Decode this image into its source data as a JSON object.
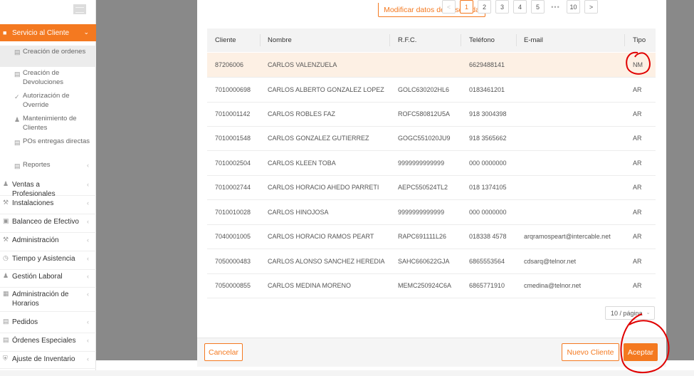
{
  "sidebar": {
    "active_menu": "Servicio al Cliente",
    "subitems": [
      {
        "label": "Creación de ordenes",
        "icon": "table-icon"
      },
      {
        "label": "Creación de Devoluciones",
        "icon": "return-icon"
      },
      {
        "label": "Autorización de Override",
        "icon": "check-icon"
      },
      {
        "label": "Mantenimiento de Clientes",
        "icon": "user-icon"
      },
      {
        "label": "POs entregas directas",
        "icon": "table-icon"
      },
      {
        "label": "Reportes",
        "icon": "table-icon"
      }
    ],
    "menus": [
      {
        "label": "Ventas a Profesionales",
        "icon": "user-icon"
      },
      {
        "label": "Instalaciones",
        "icon": "wrench-icon"
      },
      {
        "label": "Balanceo de Efectivo",
        "icon": "cash-icon"
      },
      {
        "label": "Administración",
        "icon": "wrench-icon"
      },
      {
        "label": "Tiempo y Asistencia",
        "icon": "clock-icon"
      },
      {
        "label": "Gestión Laboral",
        "icon": "users-icon"
      },
      {
        "label": "Administración de Horarios",
        "icon": "calendar-icon"
      },
      {
        "label": "Pedidos",
        "icon": "document-icon"
      },
      {
        "label": "Órdenes Especiales",
        "icon": "document-icon"
      },
      {
        "label": "Ajuste de Inventario",
        "icon": "shield-icon"
      }
    ]
  },
  "modal": {
    "modify_label": "Modificar datos de búsqueda",
    "columns": [
      "Cliente",
      "Nombre",
      "R.F.C.",
      "Teléfono",
      "E-mail",
      "Tipo"
    ],
    "rows": [
      [
        "87206006",
        "CARLOS VALENZUELA",
        "",
        "6629488141",
        "",
        "NM"
      ],
      [
        "7010000698",
        "CARLOS ALBERTO GONZALEZ LOPEZ",
        "GOLC630202HL6",
        "0183461201",
        "",
        "AR"
      ],
      [
        "7010001142",
        "CARLOS ROBLES FAZ",
        "ROFC580812U5A",
        "918 3004398",
        "",
        "AR"
      ],
      [
        "7010001548",
        "CARLOS GONZALEZ GUTIERREZ",
        "GOGC551020JU9",
        "918 3565662",
        "",
        "AR"
      ],
      [
        "7010002504",
        "CARLOS KLEEN TOBA",
        "9999999999999",
        "000 0000000",
        "",
        "AR"
      ],
      [
        "7010002744",
        "CARLOS HORACIO AHEDO PARRETI",
        "AEPC550524TL2",
        "018 1374105",
        "",
        "AR"
      ],
      [
        "7010010028",
        "CARLOS HINOJOSA",
        "9999999999999",
        "000 0000000",
        "",
        "AR"
      ],
      [
        "7040001005",
        "CARLOS HORACIO RAMOS PEART",
        "RAPC691111L26",
        "018338 4578",
        "arqramospeart@intercable.net",
        "AR"
      ],
      [
        "7050000483",
        "CARLOS ALONSO SANCHEZ HEREDIA",
        "SAHC660622GJA",
        "6865553564",
        "cdsarq@telnor.net",
        "AR"
      ],
      [
        "7050000855",
        "CARLOS MEDINA MORENO",
        "MEMC250924C6A",
        "6865771910",
        "cmedina@telnor.net",
        "AR"
      ]
    ],
    "pagination": {
      "pages": [
        "1",
        "2",
        "3",
        "4",
        "5"
      ],
      "ellipsis": "•••",
      "last": "10",
      "current": "1",
      "page_size": "10 / página",
      "prev": "<",
      "next": ">"
    },
    "cancel_label": "Cancelar",
    "new_client_label": "Nuevo Cliente",
    "accept_label": "Aceptar"
  },
  "colors": {
    "accent": "#f47920",
    "overlay": "#898989",
    "highlight_row": "#fdf0e4",
    "annotation": "#e00000"
  }
}
